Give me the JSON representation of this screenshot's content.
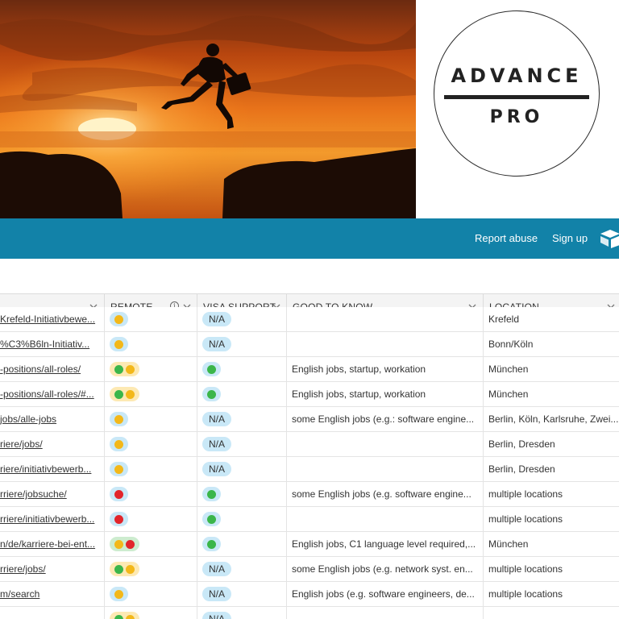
{
  "logo": {
    "top": "ADVANCE",
    "bottom": "PRO"
  },
  "nav": {
    "report_abuse": "Report abuse",
    "sign_up": "Sign up"
  },
  "columns": [
    {
      "label": "",
      "info": false
    },
    {
      "label": "REMOTE",
      "info": true
    },
    {
      "label": "VISA SUPPORT",
      "info": false
    },
    {
      "label": "GOOD TO KNOW",
      "info": false
    },
    {
      "label": "LOCATION",
      "info": false
    }
  ],
  "rows": [
    {
      "url": "Krefeld-Initiativbewe...",
      "remote": [
        "yellow"
      ],
      "remote_bg": "blue",
      "visa": "N/A",
      "good": "",
      "location": "Krefeld"
    },
    {
      "url": "%C3%B6ln-Initiativ...",
      "remote": [
        "yellow"
      ],
      "remote_bg": "blue",
      "visa": "N/A",
      "good": "",
      "location": "Bonn/Köln"
    },
    {
      "url": "-positions/all-roles/",
      "remote": [
        "green",
        "yellow"
      ],
      "remote_bg": "yellow",
      "visa": "green",
      "good": "English jobs, startup, workation",
      "location": "München"
    },
    {
      "url": "-positions/all-roles/#...",
      "remote": [
        "green",
        "yellow"
      ],
      "remote_bg": "yellow",
      "visa": "green",
      "good": "English jobs, startup, workation",
      "location": "München"
    },
    {
      "url": "jobs/alle-jobs",
      "remote": [
        "yellow"
      ],
      "remote_bg": "blue",
      "visa": "N/A",
      "good": "some English jobs (e.g.: software engine...",
      "location": "Berlin, Köln, Karlsruhe, Zwei..."
    },
    {
      "url": "riere/jobs/",
      "remote": [
        "yellow"
      ],
      "remote_bg": "blue",
      "visa": "N/A",
      "good": "",
      "location": "Berlin, Dresden"
    },
    {
      "url": "riere/initiativbewerb...",
      "remote": [
        "yellow"
      ],
      "remote_bg": "blue",
      "visa": "N/A",
      "good": "",
      "location": "Berlin, Dresden"
    },
    {
      "url": "rriere/jobsuche/",
      "remote": [
        "red"
      ],
      "remote_bg": "blue",
      "visa": "green",
      "good": "some English jobs (e.g. software engine...",
      "location": "multiple locations"
    },
    {
      "url": "rriere/initiativbewerb...",
      "remote": [
        "red"
      ],
      "remote_bg": "blue",
      "visa": "green",
      "good": "",
      "location": "multiple locations"
    },
    {
      "url": "n/de/karriere-bei-ent...",
      "remote": [
        "yellow",
        "red"
      ],
      "remote_bg": "green",
      "visa": "green",
      "good": "English jobs, C1 language level required,...",
      "location": "München"
    },
    {
      "url": "rriere/jobs/",
      "remote": [
        "green",
        "yellow"
      ],
      "remote_bg": "yellow",
      "visa": "N/A",
      "good": "some English jobs (e.g. network syst. en...",
      "location": "multiple locations"
    },
    {
      "url": "m/search",
      "remote": [
        "yellow"
      ],
      "remote_bg": "blue",
      "visa": "N/A",
      "good": "English jobs (e.g. software engineers, de...",
      "location": "multiple locations"
    },
    {
      "url": "",
      "remote": [
        "green",
        "yellow"
      ],
      "remote_bg": "yellow",
      "visa": "N/A",
      "good": "",
      "location": ""
    }
  ]
}
